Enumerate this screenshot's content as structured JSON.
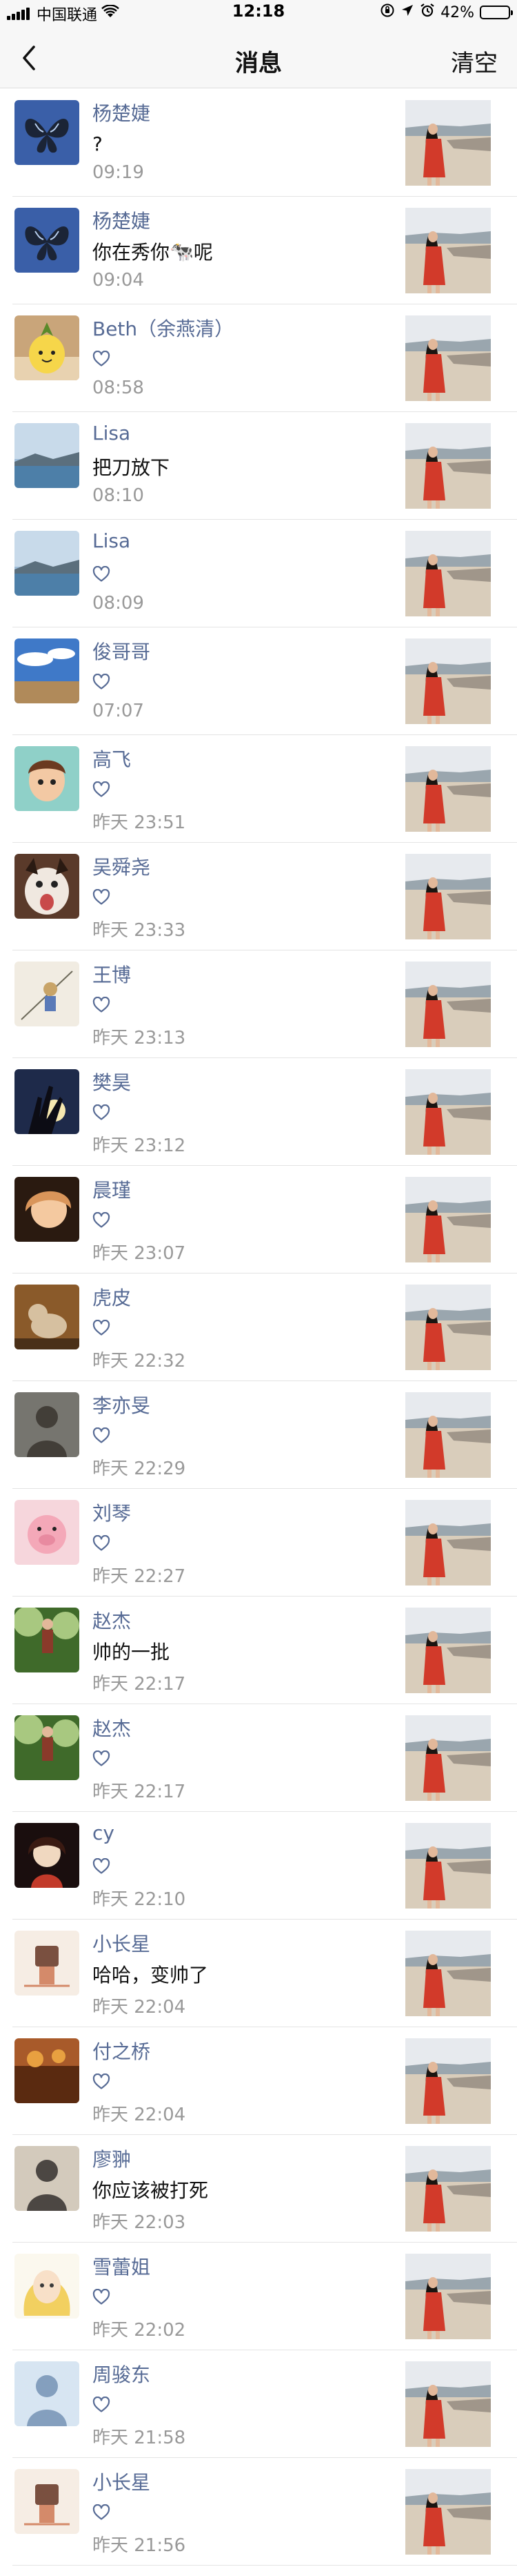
{
  "status_bar": {
    "carrier": "中国联通",
    "time": "12:18",
    "battery": "42%",
    "battery_level": 0.42
  },
  "nav": {
    "back_icon": "chevron-left-icon",
    "title": "消息",
    "clear_label": "清空"
  },
  "messages": [
    {
      "name": "杨楚婕",
      "text": "?",
      "time": "09:19",
      "like": false,
      "avatar": {
        "bg": "#3a5fa8",
        "fg": "#1b2436",
        "accent": "#b9d0f0",
        "kind": "butterfly"
      }
    },
    {
      "name": "杨楚婕",
      "text": "你在秀你",
      "emoji": "🐄",
      "text_after": "呢",
      "time": "09:04",
      "like": false,
      "avatar": {
        "bg": "#3a5fa8",
        "fg": "#1b2436",
        "accent": "#b9d0f0",
        "kind": "butterfly"
      }
    },
    {
      "name": "Beth（余燕清）",
      "text": "",
      "time": "08:58",
      "like": true,
      "avatar": {
        "bg": "#c9a57a",
        "fg": "#f6d64a",
        "accent": "#5a8a2a",
        "kind": "pineapple"
      }
    },
    {
      "name": "Lisa",
      "text": "把刀放下",
      "time": "08:10",
      "like": false,
      "avatar": {
        "bg": "#9dbcd8",
        "fg": "#5b6f7d",
        "accent": "#e5eef6",
        "kind": "landscape"
      }
    },
    {
      "name": "Lisa",
      "text": "",
      "time": "08:09",
      "like": true,
      "avatar": {
        "bg": "#9dbcd8",
        "fg": "#5b6f7d",
        "accent": "#e5eef6",
        "kind": "landscape"
      }
    },
    {
      "name": "俊哥哥",
      "text": "",
      "time": "07:07",
      "like": true,
      "avatar": {
        "bg": "#3f79c8",
        "fg": "#b08a5a",
        "accent": "#ffffff",
        "kind": "sky"
      }
    },
    {
      "name": "高飞",
      "text": "",
      "time": "昨天 23:51",
      "like": true,
      "avatar": {
        "bg": "#8fd0c8",
        "fg": "#6b3a20",
        "accent": "#f3c9a4",
        "kind": "cartoon"
      }
    },
    {
      "name": "吴舜尧",
      "text": "",
      "time": "昨天 23:33",
      "like": true,
      "avatar": {
        "bg": "#5a3a2a",
        "fg": "#f0e8e0",
        "accent": "#2a1a12",
        "kind": "dog"
      }
    },
    {
      "name": "王博",
      "text": "",
      "time": "昨天 23:13",
      "like": true,
      "avatar": {
        "bg": "#f1ece2",
        "fg": "#6d6a5a",
        "accent": "#c8a468",
        "kind": "sketch"
      }
    },
    {
      "name": "樊昊",
      "text": "",
      "time": "昨天 23:12",
      "like": true,
      "avatar": {
        "bg": "#1e2a4a",
        "fg": "#f6e8b0",
        "accent": "#7a6a9a",
        "kind": "hand"
      }
    },
    {
      "name": "晨瑾",
      "text": "",
      "time": "昨天 23:07",
      "like": true,
      "avatar": {
        "bg": "#2a1a10",
        "fg": "#d9955a",
        "accent": "#f4c9a0",
        "kind": "face"
      }
    },
    {
      "name": "虎皮",
      "text": "",
      "time": "昨天 22:32",
      "like": true,
      "avatar": {
        "bg": "#8a5a2a",
        "fg": "#d6c0a0",
        "accent": "#4a3018",
        "kind": "cat"
      }
    },
    {
      "name": "李亦旻",
      "text": "",
      "time": "昨天 22:29",
      "like": true,
      "avatar": {
        "bg": "#6a6a64",
        "fg": "#2a2622",
        "accent": "#b0aaa0",
        "kind": "person"
      }
    },
    {
      "name": "刘琴",
      "text": "",
      "time": "昨天 22:27",
      "like": true,
      "avatar": {
        "bg": "#f6d6dc",
        "fg": "#f4a8b8",
        "accent": "#ffffff",
        "kind": "pig"
      }
    },
    {
      "name": "赵杰",
      "text": "帅的一批",
      "time": "昨天 22:17",
      "like": false,
      "avatar": {
        "bg": "#3f6a2a",
        "fg": "#8a3a2a",
        "accent": "#a8c880",
        "kind": "outdoor"
      }
    },
    {
      "name": "赵杰",
      "text": "",
      "time": "昨天 22:17",
      "like": true,
      "avatar": {
        "bg": "#3f6a2a",
        "fg": "#8a3a2a",
        "accent": "#a8c880",
        "kind": "outdoor"
      }
    },
    {
      "name": "cy",
      "text": "",
      "time": "昨天 22:10",
      "like": true,
      "avatar": {
        "bg": "#1a0e0e",
        "fg": "#c23a2a",
        "accent": "#f0d8c0",
        "kind": "anime"
      }
    },
    {
      "name": "小长星",
      "text": "哈哈，变帅了",
      "time": "昨天 22:04",
      "like": false,
      "avatar": {
        "bg": "#f6ede4",
        "fg": "#d48a6a",
        "accent": "#7a5040",
        "kind": "doodle"
      }
    },
    {
      "name": "付之桥",
      "text": "",
      "time": "昨天 22:04",
      "like": true,
      "avatar": {
        "bg": "#a85a2a",
        "fg": "#e8a040",
        "accent": "#5a2a10",
        "kind": "warm"
      }
    },
    {
      "name": "廖翀",
      "text": "你应该被打死",
      "time": "昨天 22:03",
      "like": false,
      "avatar": {
        "bg": "#cfc6b8",
        "fg": "#2a2624",
        "accent": "#e8ded0",
        "kind": "person"
      }
    },
    {
      "name": "雪蕾姐",
      "text": "",
      "time": "昨天 22:02",
      "like": true,
      "avatar": {
        "bg": "#fbf8ee",
        "fg": "#f2d060",
        "accent": "#3a3a3a",
        "kind": "blonde"
      }
    },
    {
      "name": "周骏东",
      "text": "",
      "time": "昨天 21:58",
      "like": true,
      "avatar": {
        "bg": "#cfe0f0",
        "fg": "#6a8ab0",
        "accent": "#ffffff",
        "kind": "person"
      }
    },
    {
      "name": "小长星",
      "text": "",
      "time": "昨天 21:56",
      "like": true,
      "avatar": {
        "bg": "#f6ede4",
        "fg": "#d48a6a",
        "accent": "#7a5040",
        "kind": "doodle"
      }
    }
  ],
  "icons": {
    "heart": "heart-outline-icon",
    "wifi": "wifi-icon",
    "alarm": "alarm-icon",
    "location": "location-arrow-icon",
    "lock": "orientation-lock-icon",
    "battery": "battery-icon"
  },
  "thumbnail_colors": {
    "sky": "#e7eaee",
    "sea": "#9aa6ae",
    "sand": "#d9cdbb",
    "dress": "#d23a2a",
    "hair": "#1a1410",
    "skin": "#e2b89a",
    "crowd": "#5a5550"
  },
  "accent_colors": {
    "name": "#576b95",
    "time": "#999999",
    "bar": "#f7f7f7"
  }
}
